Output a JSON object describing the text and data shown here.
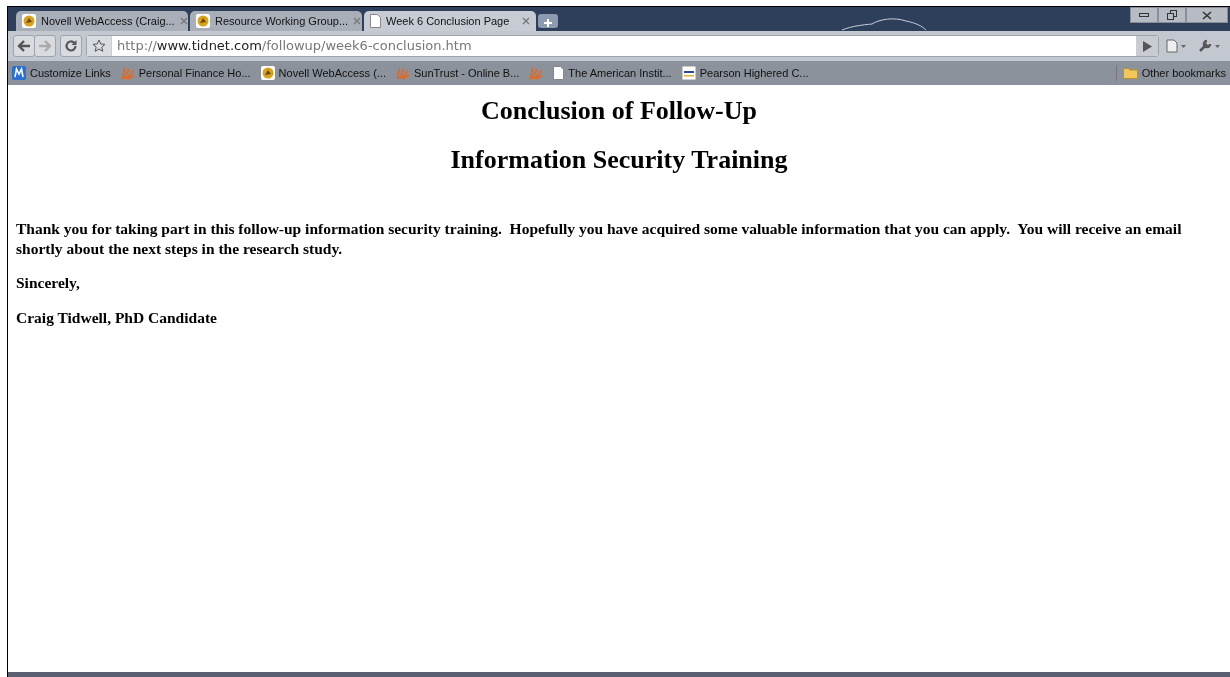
{
  "tabs": [
    {
      "label": "Novell WebAccess (Craig...",
      "kind": "pegasus",
      "selected": false
    },
    {
      "label": "Resource Working Group...",
      "kind": "pegasus",
      "selected": false
    },
    {
      "label": "Week 6 Conclusion Page",
      "kind": "page",
      "selected": true
    }
  ],
  "address": {
    "scheme": "http://",
    "host": "www.tidnet.com",
    "path": "/followup/week6-conclusion.htm"
  },
  "bookmarks": [
    {
      "label": "Customize Links",
      "kind": "m"
    },
    {
      "label": "Personal Finance Ho...",
      "kind": "sun"
    },
    {
      "label": "Novell WebAccess (...",
      "kind": "pegasus"
    },
    {
      "label": "SunTrust - Online B...",
      "kind": "sun"
    },
    {
      "kind": "sun"
    },
    {
      "label": "The American Instit...",
      "kind": "page"
    },
    {
      "label": "Pearson Highered C...",
      "kind": "pearson"
    }
  ],
  "other_bookmarks": "Other bookmarks",
  "page": {
    "headings": [
      "Conclusion of Follow-Up",
      "Information Security Training"
    ],
    "paragraphs": [
      "Thank you for taking part in this follow-up information security training.  Hopefully you have acquired some valuable information that you can apply.  You will receive an email shortly about the next steps in the research study.",
      "Sincerely,",
      "Craig Tidwell, PhD Candidate"
    ]
  }
}
